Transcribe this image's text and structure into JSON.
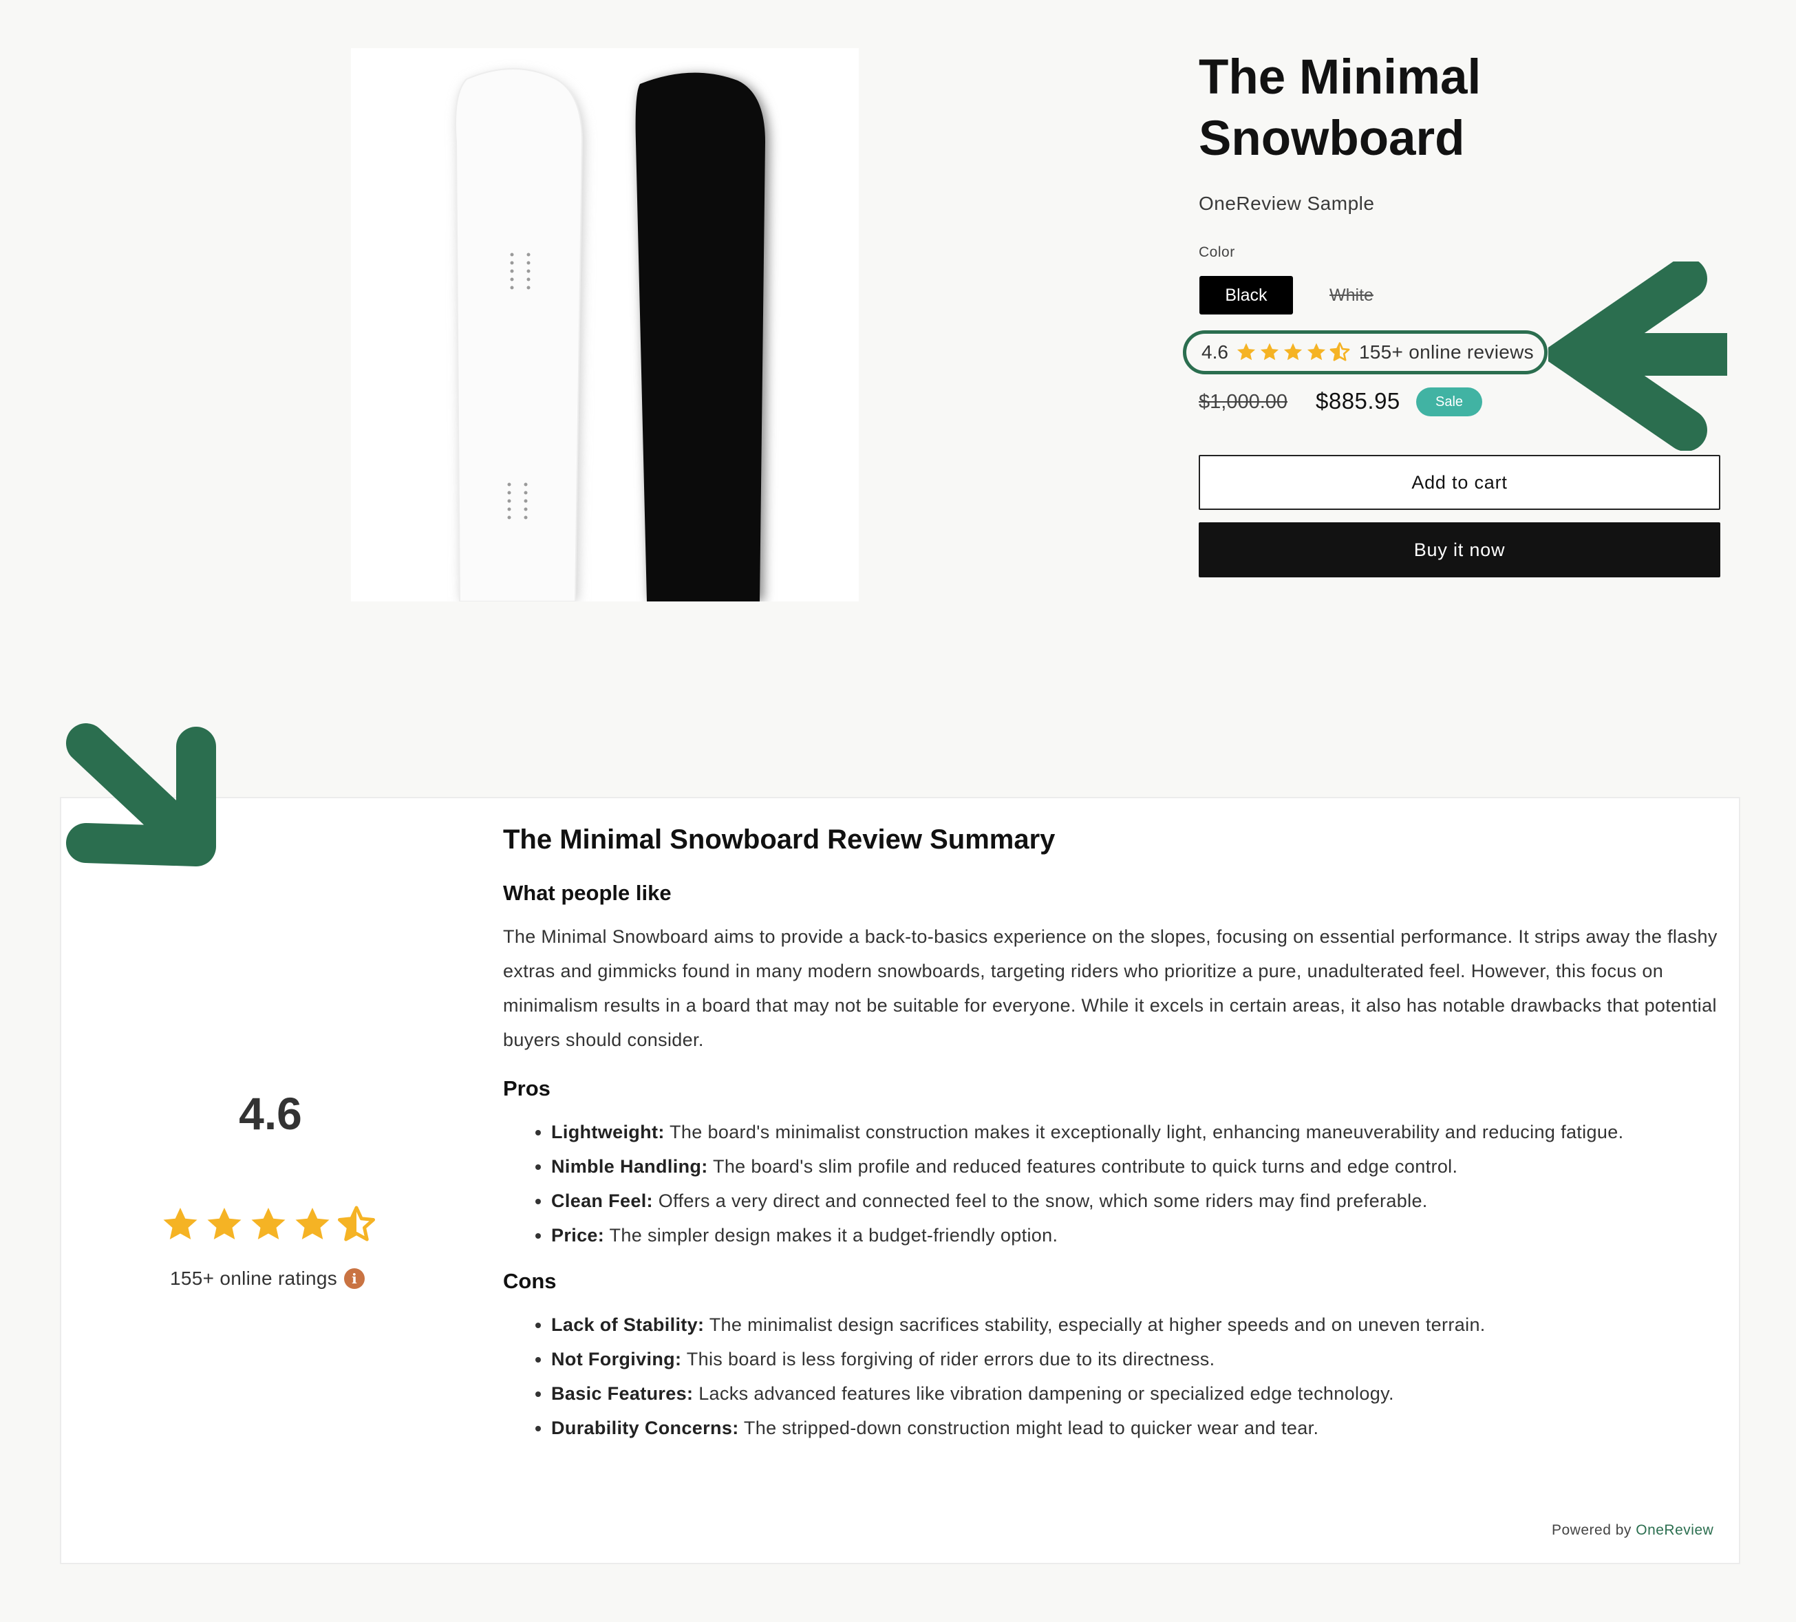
{
  "product": {
    "title": "The Minimal Snowboard",
    "vendor": "OneReview Sample",
    "color_label": "Color",
    "colors": [
      "Black",
      "White"
    ],
    "selected_color": "Black",
    "rating": "4.6",
    "rating_stars": 4.5,
    "reviews_text": "155+ online reviews",
    "price_old": "$1,000.00",
    "price_new": "$885.95",
    "sale_label": "Sale",
    "add_to_cart": "Add to cart",
    "buy_now": "Buy it now"
  },
  "review_summary": {
    "rating": "4.6",
    "rating_stars": 4.5,
    "ratings_text": "155+ online ratings",
    "info_icon": "info-icon",
    "title": "The Minimal Snowboard Review Summary",
    "like_heading": "What people like",
    "like_text": "The Minimal Snowboard aims to provide a back-to-basics experience on the slopes, focusing on essential performance. It strips away the flashy extras and gimmicks found in many modern snowboards, targeting riders who prioritize a pure, unadulterated feel. However, this focus on minimalism results in a board that may not be suitable for everyone. While it excels in certain areas, it also has notable drawbacks that potential buyers should consider.",
    "pros_heading": "Pros",
    "pros": [
      {
        "label": "Lightweight:",
        "text": " The board's minimalist construction makes it exceptionally light, enhancing maneuverability and reducing fatigue."
      },
      {
        "label": "Nimble Handling:",
        "text": " The board's slim profile and reduced features contribute to quick turns and edge control."
      },
      {
        "label": "Clean Feel:",
        "text": " Offers a very direct and connected feel to the snow, which some riders may find preferable."
      },
      {
        "label": "Price:",
        "text": " The simpler design makes it a budget-friendly option."
      }
    ],
    "cons_heading": "Cons",
    "cons": [
      {
        "label": "Lack of Stability:",
        "text": " The minimalist design sacrifices stability, especially at higher speeds and on uneven terrain."
      },
      {
        "label": "Not Forgiving:",
        "text": " This board is less forgiving of rider errors due to its directness."
      },
      {
        "label": "Basic Features:",
        "text": " Lacks advanced features like vibration dampening or specialized edge technology."
      },
      {
        "label": "Durability Concerns:",
        "text": " The stripped-down construction might lead to quicker wear and tear."
      }
    ],
    "powered_by": "Powered by ",
    "powered_brand": "OneReview"
  },
  "colors": {
    "accent_green": "#2b6e4f",
    "star": "#f5b324",
    "sale": "#41b3a3",
    "info": "#c97342"
  }
}
